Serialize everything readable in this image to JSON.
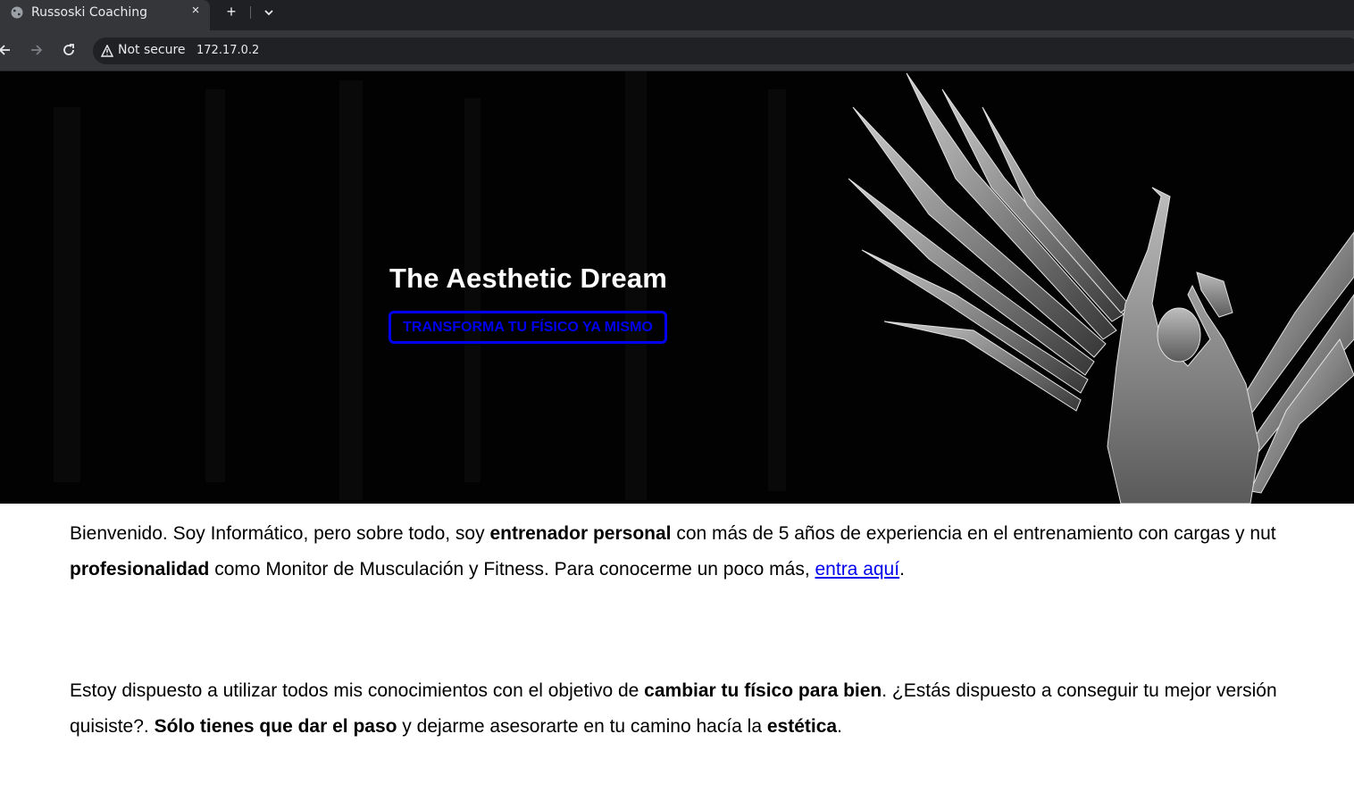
{
  "browser": {
    "tab_title": "Russoski Coaching",
    "tab_close": "×",
    "new_tab": "+",
    "security_label": "Not secure",
    "url": "172.17.0.2"
  },
  "hero": {
    "title": "The Aesthetic Dream",
    "cta_label": "TRANSFORMA TU FÍSICO YA MISMO"
  },
  "intro": {
    "line1_a": "Bienvenido. Soy Informático, pero sobre todo, soy ",
    "line1_b": "entrenador personal",
    "line1_c": " con más de 5 años de experiencia en el entrenamiento con cargas y nut",
    "line2_a": "profesionalidad",
    "line2_b": " como Monitor de Musculación y Fitness. Para conocerme un poco más, ",
    "line2_link": "entra aquí",
    "line2_c": "."
  },
  "pitch": {
    "line1_a": "Estoy dispuesto a utilizar todos mis conocimientos con el objetivo de ",
    "line1_b": "cambiar tu físico para bien",
    "line1_c": ". ¿Estás dispuesto a conseguir tu mejor versión",
    "line2_a": "quisiste?. ",
    "line2_b": "Sólo tienes que dar el paso",
    "line2_c": " y dejarme asesorarte en tu camino hacía la ",
    "line2_d": "estética",
    "line2_e": "."
  },
  "colors": {
    "link": "#0000ee",
    "hero_bg": "#020202",
    "chrome_bg": "#35363a"
  }
}
